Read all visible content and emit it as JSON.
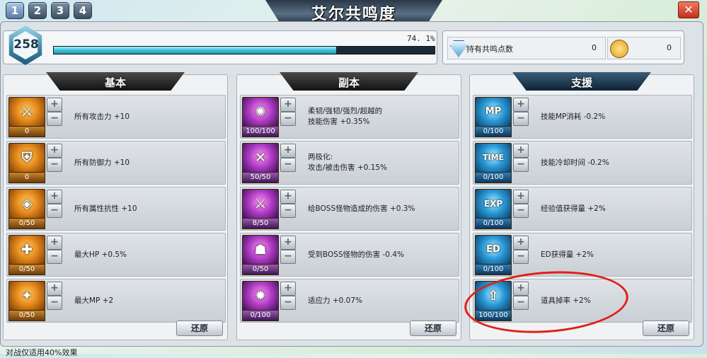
{
  "top": {
    "tabs": [
      "1",
      "2",
      "3",
      "4"
    ],
    "title": "艾尔共鸣度",
    "close_label": "✕"
  },
  "level": {
    "value": "258",
    "xp_percent_text": "74. 1%",
    "xp_fraction": 0.741
  },
  "points": {
    "label": "持有共鸣点数",
    "value": "0",
    "coin_value": "0"
  },
  "panels": [
    {
      "title": "基本",
      "reset": "还原",
      "items": [
        {
          "count": "0",
          "text": "所有攻击力 +10",
          "glyph": "⚔"
        },
        {
          "count": "0",
          "text": "所有防御力 +10",
          "glyph": "⛨"
        },
        {
          "count": "0/50",
          "text": "所有属性抗性 +10",
          "glyph": "◈"
        },
        {
          "count": "0/50",
          "text": "最大HP +0.5%",
          "glyph": "✚"
        },
        {
          "count": "0/50",
          "text": "最大MP +2",
          "glyph": "✦"
        }
      ]
    },
    {
      "title": "副本",
      "reset": "还原",
      "items": [
        {
          "count": "100/100",
          "text": "柔韧/强韧/强烈/超越的\n技能伤害 +0.35%",
          "glyph": "✺"
        },
        {
          "count": "50/50",
          "text": "两极化:\n攻击/被击伤害 +0.15%",
          "glyph": "✕"
        },
        {
          "count": "8/50",
          "text": "给BOSS怪物造成的伤害 +0.3%",
          "glyph": "⚔"
        },
        {
          "count": "0/50",
          "text": "受到BOSS怪物的伤害 -0.4%",
          "glyph": "☗"
        },
        {
          "count": "0/100",
          "text": "适应力 +0.07%",
          "glyph": "✹"
        }
      ]
    },
    {
      "title": "支援",
      "reset": "还原",
      "items": [
        {
          "count": "0/100",
          "text": "技能MP消耗 -0.2%",
          "glyph": "MP"
        },
        {
          "count": "0/100",
          "text": "技能冷却时间 -0.2%",
          "glyph": "TIME"
        },
        {
          "count": "0/100",
          "text": "经验值获得量 +2%",
          "glyph": "EXP"
        },
        {
          "count": "0/100",
          "text": "ED获得量 +2%",
          "glyph": "ED"
        },
        {
          "count": "100/100",
          "text": "道具掉率 +2%",
          "glyph": "⇧"
        }
      ]
    }
  ],
  "footer": "对战仅适用40%效果"
}
